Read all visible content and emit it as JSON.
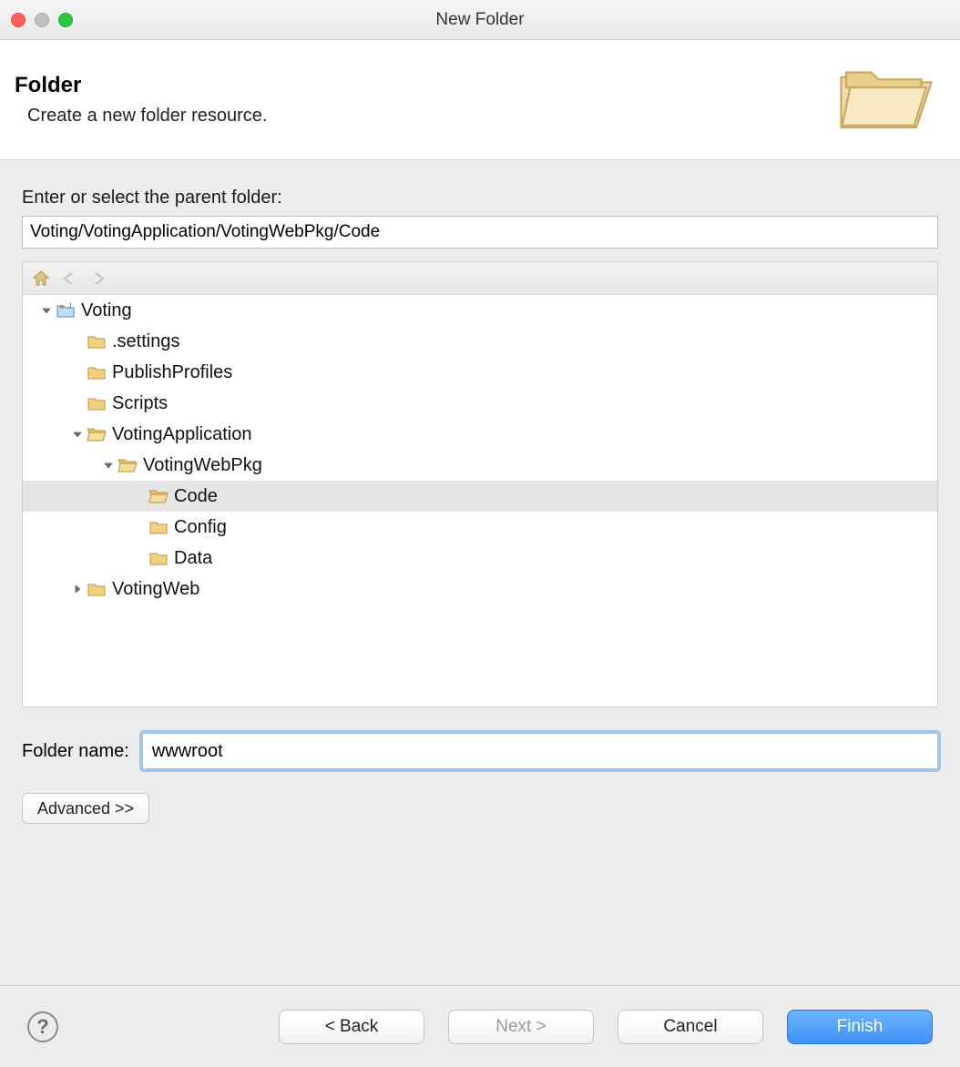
{
  "window": {
    "title": "New Folder"
  },
  "banner": {
    "heading": "Folder",
    "subheading": "Create a new folder resource."
  },
  "labels": {
    "parent_folder": "Enter or select the parent folder:",
    "folder_name": "Folder name:"
  },
  "inputs": {
    "parent_path": "Voting/VotingApplication/VotingWebPkg/Code",
    "folder_name": "wwwroot"
  },
  "tree": [
    {
      "label": "Voting",
      "indent": 0,
      "icon": "project",
      "expanded": true,
      "hasChildren": true,
      "selected": false
    },
    {
      "label": ".settings",
      "indent": 1,
      "icon": "folder",
      "expanded": false,
      "hasChildren": false,
      "selected": false
    },
    {
      "label": "PublishProfiles",
      "indent": 1,
      "icon": "folder",
      "expanded": false,
      "hasChildren": false,
      "selected": false
    },
    {
      "label": "Scripts",
      "indent": 1,
      "icon": "folder",
      "expanded": false,
      "hasChildren": false,
      "selected": false
    },
    {
      "label": "VotingApplication",
      "indent": 1,
      "icon": "folder-open",
      "expanded": true,
      "hasChildren": true,
      "selected": false
    },
    {
      "label": "VotingWebPkg",
      "indent": 2,
      "icon": "folder-open",
      "expanded": true,
      "hasChildren": true,
      "selected": false
    },
    {
      "label": "Code",
      "indent": 3,
      "icon": "folder-open",
      "expanded": false,
      "hasChildren": false,
      "selected": true
    },
    {
      "label": "Config",
      "indent": 3,
      "icon": "folder",
      "expanded": false,
      "hasChildren": false,
      "selected": false
    },
    {
      "label": "Data",
      "indent": 3,
      "icon": "folder",
      "expanded": false,
      "hasChildren": false,
      "selected": false
    },
    {
      "label": "VotingWeb",
      "indent": 1,
      "icon": "folder",
      "expanded": false,
      "hasChildren": true,
      "selected": false
    }
  ],
  "buttons": {
    "advanced": "Advanced >>",
    "back": "< Back",
    "next": "Next >",
    "cancel": "Cancel",
    "finish": "Finish"
  }
}
